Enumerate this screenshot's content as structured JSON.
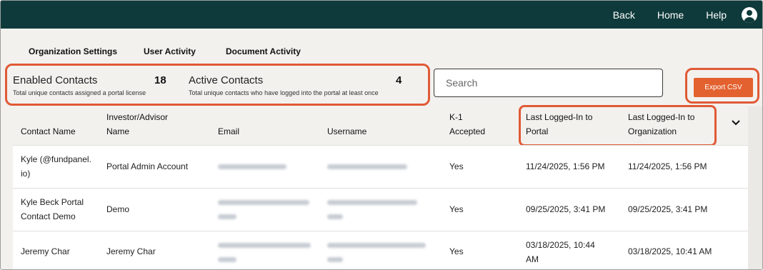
{
  "topnav": {
    "back": "Back",
    "home": "Home",
    "help": "Help",
    "user_icon": "user-account-icon"
  },
  "tabs": [
    "Organization Settings",
    "User Activity",
    "Document Activity"
  ],
  "stats": {
    "enabled": {
      "label": "Enabled Contacts",
      "value": "18",
      "sub": "Total unique contacts assigned a portal license"
    },
    "active": {
      "label": "Active Contacts",
      "value": "4",
      "sub": "Total unique contacts who have logged into the portal at least once"
    }
  },
  "search": {
    "placeholder": "Search",
    "value": ""
  },
  "export": {
    "label": "Export CSV"
  },
  "table": {
    "headers": {
      "contact_name": "Contact Name",
      "investor_1": "Investor/Advisor",
      "investor_2": "Name",
      "email": "Email",
      "username": "Username",
      "k1_1": "K-1",
      "k1_2": "Accepted",
      "portal_1": "Last Logged-In to",
      "portal_2": "Portal",
      "org_1": "Last Logged-In to",
      "org_2": "Organization"
    },
    "rows": [
      {
        "contact_1": "Kyle (@fundpanel.",
        "contact_2": "io)",
        "investor": "Portal Admin Account",
        "k1": "Yes",
        "portal": "11/24/2025, 1:56 PM",
        "org": "11/24/2025, 1:56 PM"
      },
      {
        "contact_1": "Kyle Beck Portal",
        "contact_2": "Contact Demo",
        "investor": "Demo",
        "k1": "Yes",
        "portal": "09/25/2025, 3:41 PM",
        "org": "09/25/2025, 3:41 PM"
      },
      {
        "contact_1": "Jeremy Char",
        "contact_2": "",
        "investor": "Jeremy Char",
        "k1": "Yes",
        "portal_1": "03/18/2025, 10:44",
        "portal_2": "AM",
        "org": "03/18/2025, 10:41 AM"
      }
    ]
  },
  "colors": {
    "topbar": "#0f3a3b",
    "accent": "#e3612f",
    "highlight": "#e05a36"
  }
}
